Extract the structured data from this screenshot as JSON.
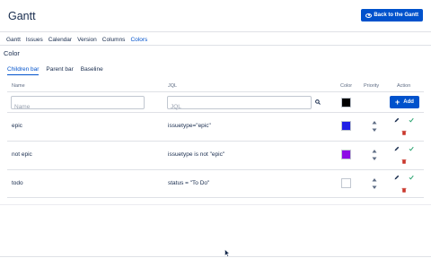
{
  "header": {
    "title": "Gantt",
    "back_label": "Back to the Gantt"
  },
  "tabs": [
    {
      "label": "Gantt",
      "active": false
    },
    {
      "label": "Issues",
      "active": false
    },
    {
      "label": "Calendar",
      "active": false
    },
    {
      "label": "Version",
      "active": false
    },
    {
      "label": "Columns",
      "active": false
    },
    {
      "label": "Colors",
      "active": true
    }
  ],
  "section": {
    "title": "Color"
  },
  "subtabs": [
    {
      "label": "Children bar",
      "active": true
    },
    {
      "label": "Parent bar",
      "active": false
    },
    {
      "label": "Baseline",
      "active": false
    }
  ],
  "table": {
    "headers": {
      "name": "Name",
      "jql": "JQL",
      "color": "Color",
      "priority": "Priority",
      "action": "Action"
    },
    "new_row": {
      "name_placeholder": "Name",
      "jql_placeholder": "JQL",
      "color": "#000000",
      "add_label": "Add"
    },
    "rows": [
      {
        "name": "epic",
        "jql": "issuetype=\"epic\"",
        "color": "#1f1fe6"
      },
      {
        "name": "not epic",
        "jql": "issuetype is not \"epic\"",
        "color": "#8d0ae6"
      },
      {
        "name": "todo",
        "jql": "status = \"To Do\"",
        "color": "#ffffff"
      }
    ]
  },
  "colors": {
    "accent": "#0052cc",
    "delete": "#c9372c",
    "confirm": "#22a06b"
  }
}
